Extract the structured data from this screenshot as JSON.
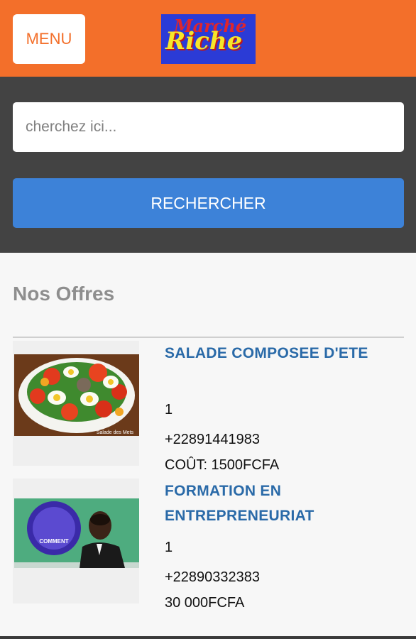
{
  "header": {
    "menu_label": "MENU",
    "logo_top": "Marché",
    "logo_main": "Riche"
  },
  "search": {
    "placeholder": "cherchez ici...",
    "button_label": "RECHERCHER"
  },
  "offers_section": {
    "heading": "Nos Offres",
    "items": [
      {
        "title": "SALADE COMPOSEE D'ETE",
        "quantity": "1",
        "phone": "+22891441983",
        "price": "COÛT: 1500FCFA",
        "image_caption": "Salade des Mets"
      },
      {
        "title": "FORMATION EN ENTREPRENEURIAT",
        "quantity": "1",
        "phone": "+22890332383",
        "price": "30 000FCFA",
        "image_caption": "COMMENT"
      }
    ]
  },
  "colors": {
    "header": "#f36f2a",
    "search_bar": "#434343",
    "button": "#3d82d8",
    "title": "#2a6aa8"
  }
}
